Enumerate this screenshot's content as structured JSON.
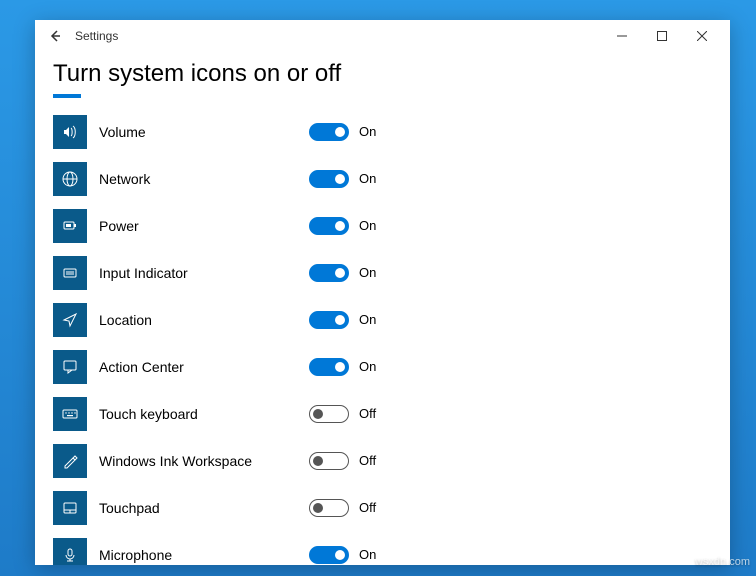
{
  "window": {
    "title": "Settings",
    "watermark": "wsxdn.com"
  },
  "page": {
    "heading": "Turn system icons on or off",
    "on_label": "On",
    "off_label": "Off"
  },
  "items": [
    {
      "name": "Volume",
      "state": true,
      "icon": "volume"
    },
    {
      "name": "Network",
      "state": true,
      "icon": "network"
    },
    {
      "name": "Power",
      "state": true,
      "icon": "power"
    },
    {
      "name": "Input Indicator",
      "state": true,
      "icon": "input-indicator"
    },
    {
      "name": "Location",
      "state": true,
      "icon": "location"
    },
    {
      "name": "Action Center",
      "state": true,
      "icon": "action-center"
    },
    {
      "name": "Touch keyboard",
      "state": false,
      "icon": "touch-keyboard"
    },
    {
      "name": "Windows Ink Workspace",
      "state": false,
      "icon": "ink"
    },
    {
      "name": "Touchpad",
      "state": false,
      "icon": "touchpad"
    },
    {
      "name": "Microphone",
      "state": true,
      "icon": "microphone"
    }
  ]
}
